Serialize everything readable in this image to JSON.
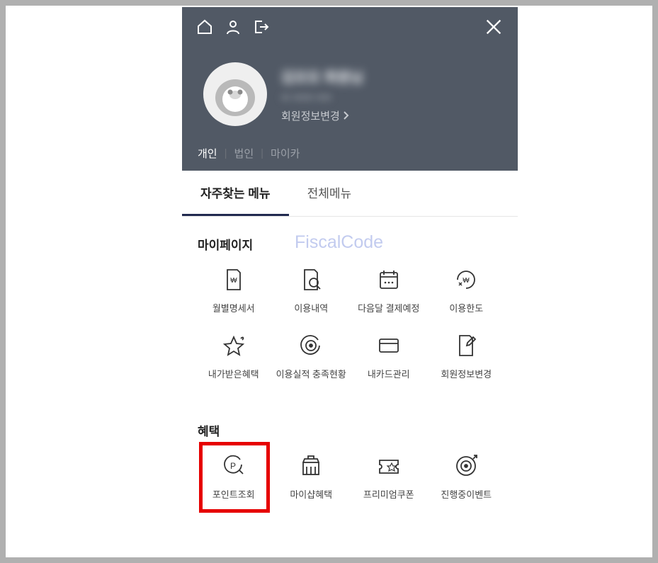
{
  "toolbar": {
    "home_icon": "home",
    "user_icon": "user",
    "logout_icon": "logout",
    "close_icon": "close"
  },
  "profile": {
    "blurred_name": "김모모 회원님",
    "blurred_sub": "ID 0000 000",
    "edit_link": "회원정보변경"
  },
  "account_tabs": {
    "items": [
      "개인",
      "법인",
      "마이카"
    ],
    "active": 0
  },
  "menu_tabs": {
    "items": [
      "자주찾는 메뉴",
      "전체메뉴"
    ],
    "active": 0
  },
  "watermark": "FiscalCode",
  "sections": {
    "mypage": {
      "title": "마이페이지",
      "items": [
        {
          "label": "월별명세서",
          "icon": "statement"
        },
        {
          "label": "이용내역",
          "icon": "history"
        },
        {
          "label": "다음달 결제예정",
          "icon": "schedule"
        },
        {
          "label": "이용한도",
          "icon": "limit"
        },
        {
          "label": "내가받은혜택",
          "icon": "star"
        },
        {
          "label": "이용실적 충족현황",
          "icon": "target"
        },
        {
          "label": "내카드관리",
          "icon": "card"
        },
        {
          "label": "회원정보변경",
          "icon": "edit"
        }
      ]
    },
    "benefits": {
      "title": "혜택",
      "items": [
        {
          "label": "포인트조회",
          "icon": "point",
          "highlight": true
        },
        {
          "label": "마이샵혜택",
          "icon": "shop"
        },
        {
          "label": "프리미엄쿠폰",
          "icon": "coupon"
        },
        {
          "label": "진행중이벤트",
          "icon": "event"
        }
      ]
    }
  }
}
